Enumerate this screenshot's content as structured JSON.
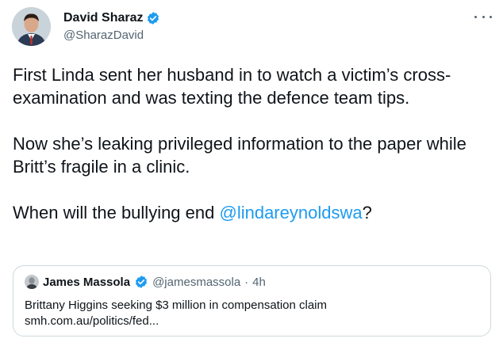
{
  "author": {
    "name": "David Sharaz",
    "handle": "@SharazDavid"
  },
  "tweet": {
    "paragraph_1": "First Linda sent her husband in to watch a victim’s cross-examination and was texting the defence team tips.",
    "paragraph_2": "Now she’s leaking privileged information to the paper while Britt’s fragile in a clinic.",
    "paragraph_3_text": "When will the bullying end ",
    "paragraph_3_mention": "@lindareynoldswa",
    "paragraph_3_end": "?"
  },
  "quoted_tweet": {
    "name": "James Massola",
    "handle": "@jamesmassola",
    "separator": "·",
    "time": "4h",
    "text": "Brittany Higgins seeking $3 million in compensation claim",
    "link": "smh.com.au/politics/fed..."
  },
  "colors": {
    "accent": "#1d9bf0",
    "text": "#0f1419",
    "muted": "#536471",
    "border": "#cfd9de"
  },
  "icons": {
    "verified": "verified-badge-icon",
    "more": "more-horizontal-icon"
  }
}
